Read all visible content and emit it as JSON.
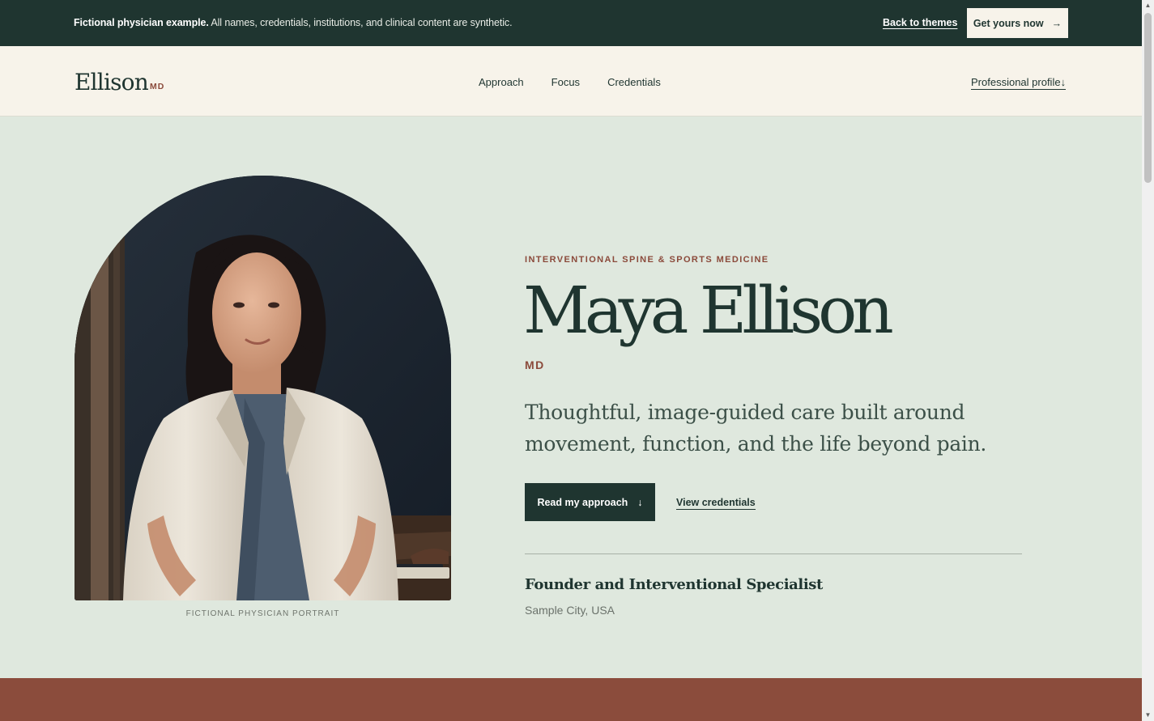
{
  "notice": {
    "bold": "Fictional physician example.",
    "text": " All names, credentials, institutions, and clinical content are synthetic.",
    "back_link": "Back to themes",
    "cta_label": "Get yours now",
    "cta_icon": "→"
  },
  "nav": {
    "brand": "Ellison",
    "brand_suffix": "MD",
    "links": [
      "Approach",
      "Focus",
      "Credentials"
    ],
    "profile_link": "Professional profile",
    "profile_icon": "↓"
  },
  "hero": {
    "portrait_caption": "FICTIONAL PHYSICIAN PORTRAIT",
    "eyebrow": "INTERVENTIONAL SPINE & SPORTS MEDICINE",
    "name": "Maya Ellison",
    "credential": "MD",
    "tagline": "Thoughtful, image-guided care built around movement, function, and the life beyond pain.",
    "primary_button": "Read my approach",
    "primary_icon": "↓",
    "secondary_link": "View credentials",
    "role": "Founder and Interventional Specialist",
    "location": "Sample City, USA"
  },
  "colors": {
    "dark_green": "#1f3530",
    "cream": "#f7f3ea",
    "sage": "#dfe8de",
    "terracotta": "#8b4a3b"
  },
  "icons": {
    "scroll_up": "▲",
    "scroll_down": "▼"
  }
}
